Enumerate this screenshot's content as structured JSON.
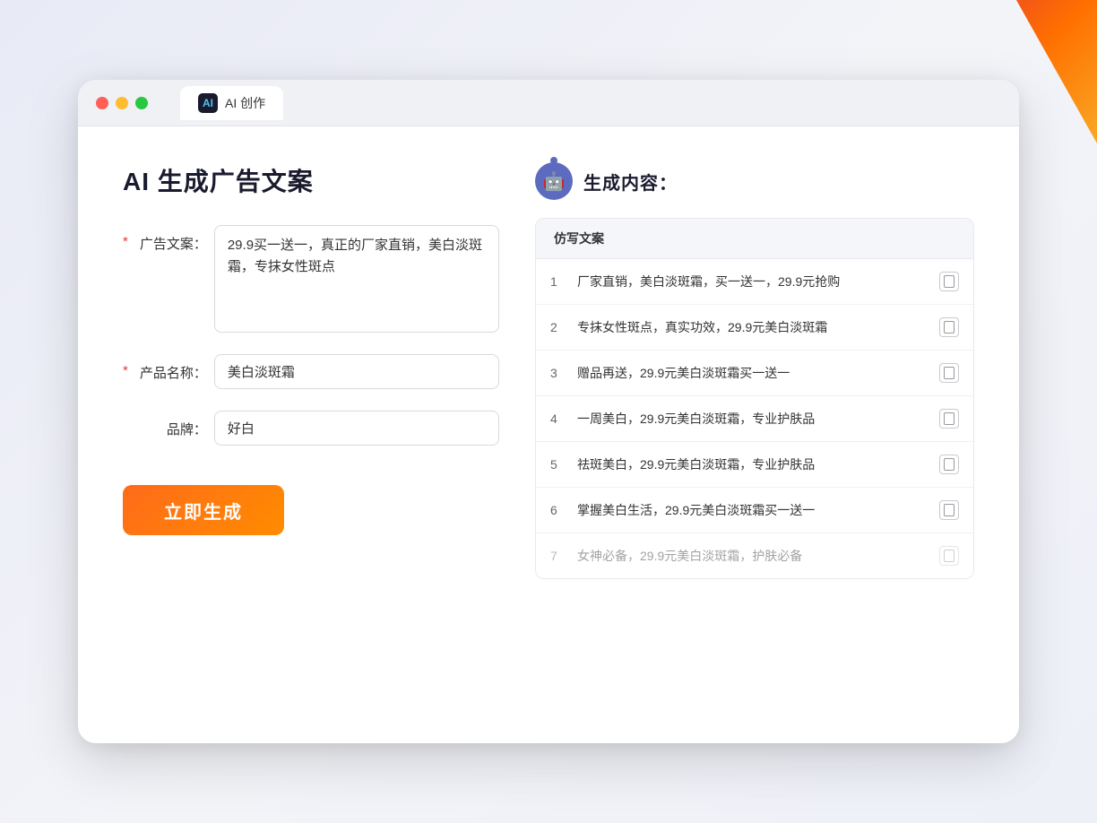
{
  "decorations": {
    "corner": "top-right triangle decoration"
  },
  "browser": {
    "tab_label": "AI 创作",
    "tab_icon": "AI"
  },
  "left_panel": {
    "page_title": "AI 生成广告文案",
    "form": {
      "ad_copy_label": "广告文案：",
      "ad_copy_required": "*",
      "ad_copy_value": "29.9买一送一，真正的厂家直销，美白淡斑霜，专抹女性斑点",
      "product_name_label": "产品名称：",
      "product_name_required": "*",
      "product_name_value": "美白淡斑霜",
      "brand_label": "品牌：",
      "brand_value": "好白"
    },
    "generate_button": "立即生成"
  },
  "right_panel": {
    "title": "生成内容：",
    "table_header": "仿写文案",
    "results": [
      {
        "id": 1,
        "text": "厂家直销，美白淡斑霜，买一送一，29.9元抢购",
        "faded": false
      },
      {
        "id": 2,
        "text": "专抹女性斑点，真实功效，29.9元美白淡斑霜",
        "faded": false
      },
      {
        "id": 3,
        "text": "赠品再送，29.9元美白淡斑霜买一送一",
        "faded": false
      },
      {
        "id": 4,
        "text": "一周美白，29.9元美白淡斑霜，专业护肤品",
        "faded": false
      },
      {
        "id": 5,
        "text": "祛斑美白，29.9元美白淡斑霜，专业护肤品",
        "faded": false
      },
      {
        "id": 6,
        "text": "掌握美白生活，29.9元美白淡斑霜买一送一",
        "faded": false
      },
      {
        "id": 7,
        "text": "女神必备，29.9元美白淡斑霜，护肤必备",
        "faded": true
      }
    ]
  }
}
